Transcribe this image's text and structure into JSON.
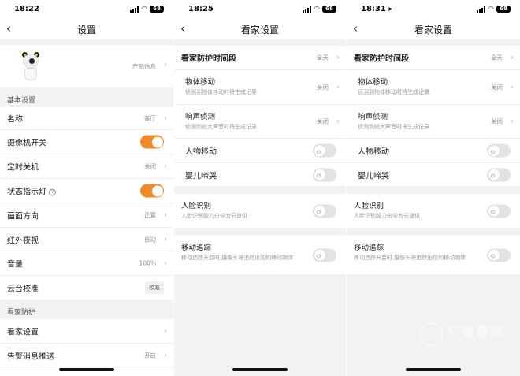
{
  "screens": [
    {
      "time": "18:22",
      "battery": "68",
      "title": "设置",
      "product_info": "产品信息",
      "sections": {
        "basic": "基本设置",
        "guard": "看家防护"
      },
      "rows": {
        "name": {
          "label": "名称",
          "value": "客厅"
        },
        "camera_switch": {
          "label": "摄像机开关",
          "state": "on"
        },
        "timer_off": {
          "label": "定时关机",
          "value": "关闭"
        },
        "status_light": {
          "label": "状态指示灯",
          "help": "?",
          "state": "on"
        },
        "orientation": {
          "label": "画面方向",
          "value": "正置"
        },
        "ir_night": {
          "label": "红外夜视",
          "value": "自动"
        },
        "volume": {
          "label": "音量",
          "value": "100%"
        },
        "ptz_calib": {
          "label": "云台校准",
          "button": "校准"
        },
        "guard_settings": {
          "label": "看家设置"
        },
        "alert_push": {
          "label": "告警消息推送",
          "value": "开启"
        }
      }
    },
    {
      "time": "18:25",
      "battery": "68",
      "title": "看家设置",
      "rows": {
        "period": {
          "label": "看家防护时间段",
          "value": "全天"
        },
        "motion": {
          "label": "物体移动",
          "sub": "侦测到物体移动时将生成记录",
          "value": "关闭"
        },
        "sound": {
          "label": "响声侦测",
          "sub": "侦测到较大声音时将生成记录",
          "value": "关闭"
        },
        "human": {
          "label": "人物移动",
          "state": "off"
        },
        "baby": {
          "label": "婴儿啼哭",
          "state": "off"
        },
        "face": {
          "label": "人脸识别",
          "sub": "人脸识别能力由华为云提供",
          "state": "off"
        },
        "tracking": {
          "label": "移动追踪",
          "sub": "移动追踪开启时,摄像头将追踪出现的移动物体",
          "state": "off"
        }
      }
    },
    {
      "time": "18:31",
      "battery": "68",
      "title": "看家设置",
      "rows": {
        "period": {
          "label": "看家防护时间段",
          "value": "全天"
        },
        "motion": {
          "label": "物体移动",
          "sub": "侦测到物体移动时将生成记录",
          "value": "关闭"
        },
        "sound": {
          "label": "响声侦测",
          "sub": "侦测到较大声音时将生成记录",
          "value": "关闭"
        },
        "human": {
          "label": "人物移动",
          "state": "off"
        },
        "baby": {
          "label": "婴儿啼哭",
          "state": "off"
        },
        "face": {
          "label": "人脸识别",
          "sub": "人脸识别能力由华为云提供",
          "state": "off"
        },
        "tracking": {
          "label": "移动追踪",
          "sub": "移动追踪开启时,摄像头将追踪出现的移动物体",
          "state": "off"
        }
      }
    }
  ],
  "watermark": {
    "text": "亿智蘑菇",
    "sub": "yizhimogu"
  },
  "colors": {
    "accent": "#ee8a2c",
    "toggle_off": "#e3e3e3",
    "page_bg": "#f2f2f4"
  },
  "icons": {
    "back": "chevron-left-icon",
    "row_arrow": "chevron-right-icon",
    "location": "location-arrow-icon"
  }
}
